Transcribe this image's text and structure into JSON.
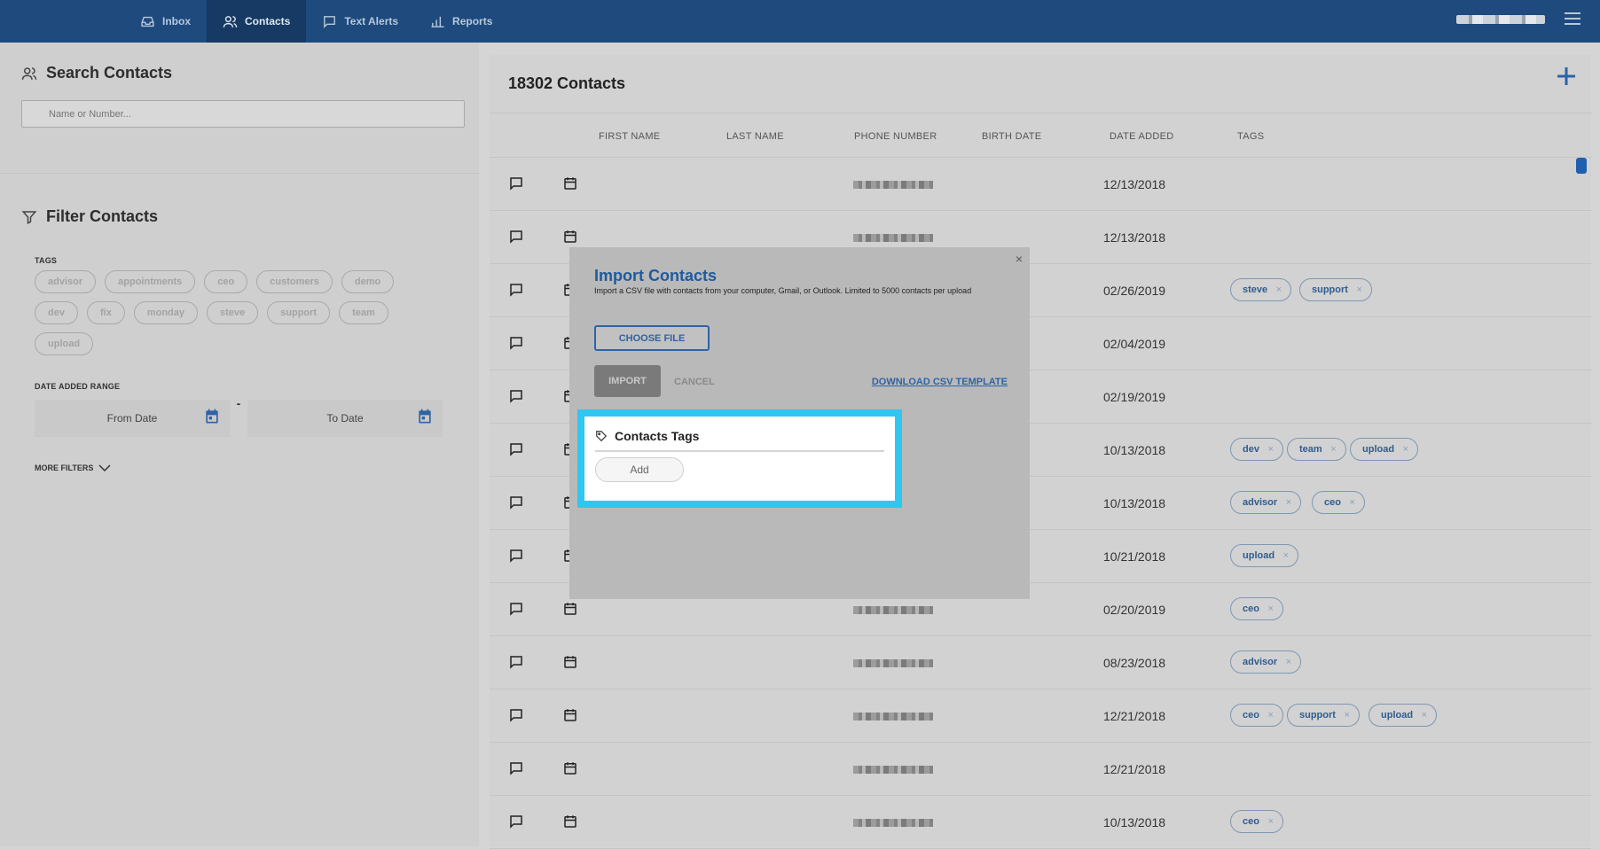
{
  "nav": {
    "items": [
      {
        "label": "Inbox",
        "icon": "inbox-icon"
      },
      {
        "label": "Contacts",
        "icon": "contacts-icon",
        "active": true
      },
      {
        "label": "Text Alerts",
        "icon": "chat-icon"
      },
      {
        "label": "Reports",
        "icon": "bar-chart-icon"
      }
    ]
  },
  "search": {
    "title": "Search Contacts",
    "placeholder": "Name or Number..."
  },
  "filter": {
    "title": "Filter Contacts",
    "tags_label": "TAGS",
    "tags": [
      "advisor",
      "appointments",
      "ceo",
      "customers",
      "demo",
      "dev",
      "fix",
      "monday",
      "steve",
      "support",
      "team",
      "upload"
    ],
    "date_range_label": "DATE ADDED RANGE",
    "from_date": "From Date",
    "to_date": "To Date",
    "separator": "-",
    "more_filters": "MORE FILTERS"
  },
  "contacts": {
    "title": "18302 Contacts",
    "columns": [
      "FIRST NAME",
      "LAST NAME",
      "PHONE NUMBER",
      "BIRTH DATE",
      "DATE ADDED",
      "TAGS"
    ],
    "rows": [
      {
        "date": "12/13/2018",
        "tags": []
      },
      {
        "date": "12/13/2018",
        "tags": []
      },
      {
        "date": "02/26/2019",
        "tags": [
          "steve",
          "support"
        ]
      },
      {
        "date": "02/04/2019",
        "tags": []
      },
      {
        "date": "02/19/2019",
        "tags": []
      },
      {
        "date": "10/13/2018",
        "tags": [
          "dev",
          "team",
          "upload"
        ]
      },
      {
        "date": "10/13/2018",
        "tags": [
          "advisor",
          "ceo"
        ]
      },
      {
        "date": "10/21/2018",
        "tags": [
          "upload"
        ]
      },
      {
        "date": "02/20/2019",
        "tags": [
          "ceo"
        ]
      },
      {
        "date": "08/23/2018",
        "tags": [
          "advisor"
        ]
      },
      {
        "date": "12/21/2018",
        "tags": [
          "ceo",
          "support",
          "upload"
        ]
      },
      {
        "date": "12/21/2018",
        "tags": []
      },
      {
        "date": "10/13/2018",
        "tags": [
          "ceo"
        ]
      }
    ]
  },
  "modal": {
    "title": "Import Contacts",
    "description": "Import a CSV file with contacts from your computer, Gmail, or Outlook. Limited to 5000 contacts per upload",
    "close": "×",
    "choose_file": "CHOOSE FILE",
    "import": "IMPORT",
    "cancel": "CANCEL",
    "download": "DOWNLOAD CSV TEMPLATE",
    "tags_title": "Contacts Tags",
    "add": "Add"
  },
  "colors": {
    "topbar": "#1e4a7d",
    "accent": "#2e63a5",
    "highlight": "#2fc6f2"
  }
}
